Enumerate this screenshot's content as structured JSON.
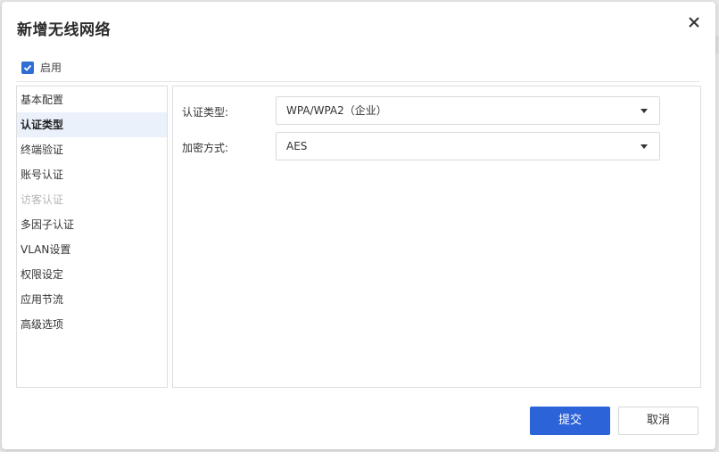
{
  "dialog": {
    "title": "新增无线网络",
    "close_icon": "close-icon"
  },
  "enable": {
    "label": "启用",
    "checked": true
  },
  "sidebar": {
    "items": [
      {
        "label": "基本配置",
        "state": "normal"
      },
      {
        "label": "认证类型",
        "state": "active"
      },
      {
        "label": "终端验证",
        "state": "normal"
      },
      {
        "label": "账号认证",
        "state": "normal"
      },
      {
        "label": "访客认证",
        "state": "disabled"
      },
      {
        "label": "多因子认证",
        "state": "normal"
      },
      {
        "label": "VLAN设置",
        "state": "normal"
      },
      {
        "label": "权限设定",
        "state": "normal"
      },
      {
        "label": "应用节流",
        "state": "normal"
      },
      {
        "label": "高级选项",
        "state": "normal"
      }
    ]
  },
  "form": {
    "auth_type": {
      "label": "认证类型:",
      "value": "WPA/WPA2（企业）"
    },
    "encryption": {
      "label": "加密方式:",
      "value": "AES"
    }
  },
  "buttons": {
    "submit": "提交",
    "cancel": "取消"
  },
  "colors": {
    "primary": "#2d63d8",
    "active_bg": "#eaf1fb",
    "checkbox": "#2f6ed3"
  }
}
